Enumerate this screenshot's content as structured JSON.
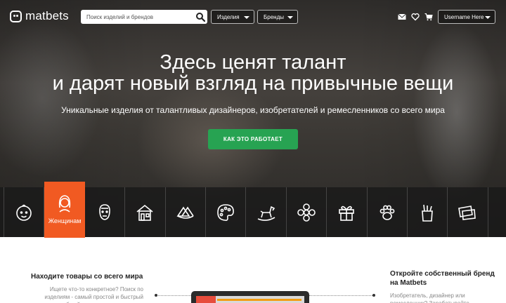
{
  "brand": {
    "name": "matbets"
  },
  "header": {
    "search_placeholder": "Поиск изделий и брендов",
    "items_dropdown": "Изделия",
    "brands_dropdown": "Бренды",
    "user_dropdown": "Username Here",
    "icons": [
      "mail-icon",
      "heart-icon",
      "cart-icon"
    ]
  },
  "hero": {
    "title_line1": "Здесь ценят талант",
    "title_line2": "и дарят новый взгляд на привычные вещи",
    "subtitle": "Уникальные изделия от талантливых дизайнеров, изобретателей и ремесленников со всего мира",
    "cta": "КАК ЭТО РАБОТАЕТ"
  },
  "categories": [
    {
      "icon": "baby-icon"
    },
    {
      "icon": "woman-icon",
      "label": "Женщинам",
      "active": true
    },
    {
      "icon": "man-icon"
    },
    {
      "icon": "house-icon"
    },
    {
      "icon": "food-icon"
    },
    {
      "icon": "palette-icon"
    },
    {
      "icon": "rocking-horse-icon"
    },
    {
      "icon": "flower-icon"
    },
    {
      "icon": "gift-icon"
    },
    {
      "icon": "paw-icon"
    },
    {
      "icon": "stationery-icon"
    },
    {
      "icon": "cards-icon"
    }
  ],
  "info_left": {
    "title": "Находите товары со всего мира",
    "text": "Ищете что-то конкретное? Поиск по изделиям - самый простой и быстрый способ найти именно то, что нужно"
  },
  "info_right": {
    "title": "Откройте собственный бренд на Matbets",
    "text": "Изобретатель, дизайнер или ремесленник? Зарабатывайте"
  },
  "colors": {
    "accent": "#f15a22",
    "cta": "#27a352"
  }
}
